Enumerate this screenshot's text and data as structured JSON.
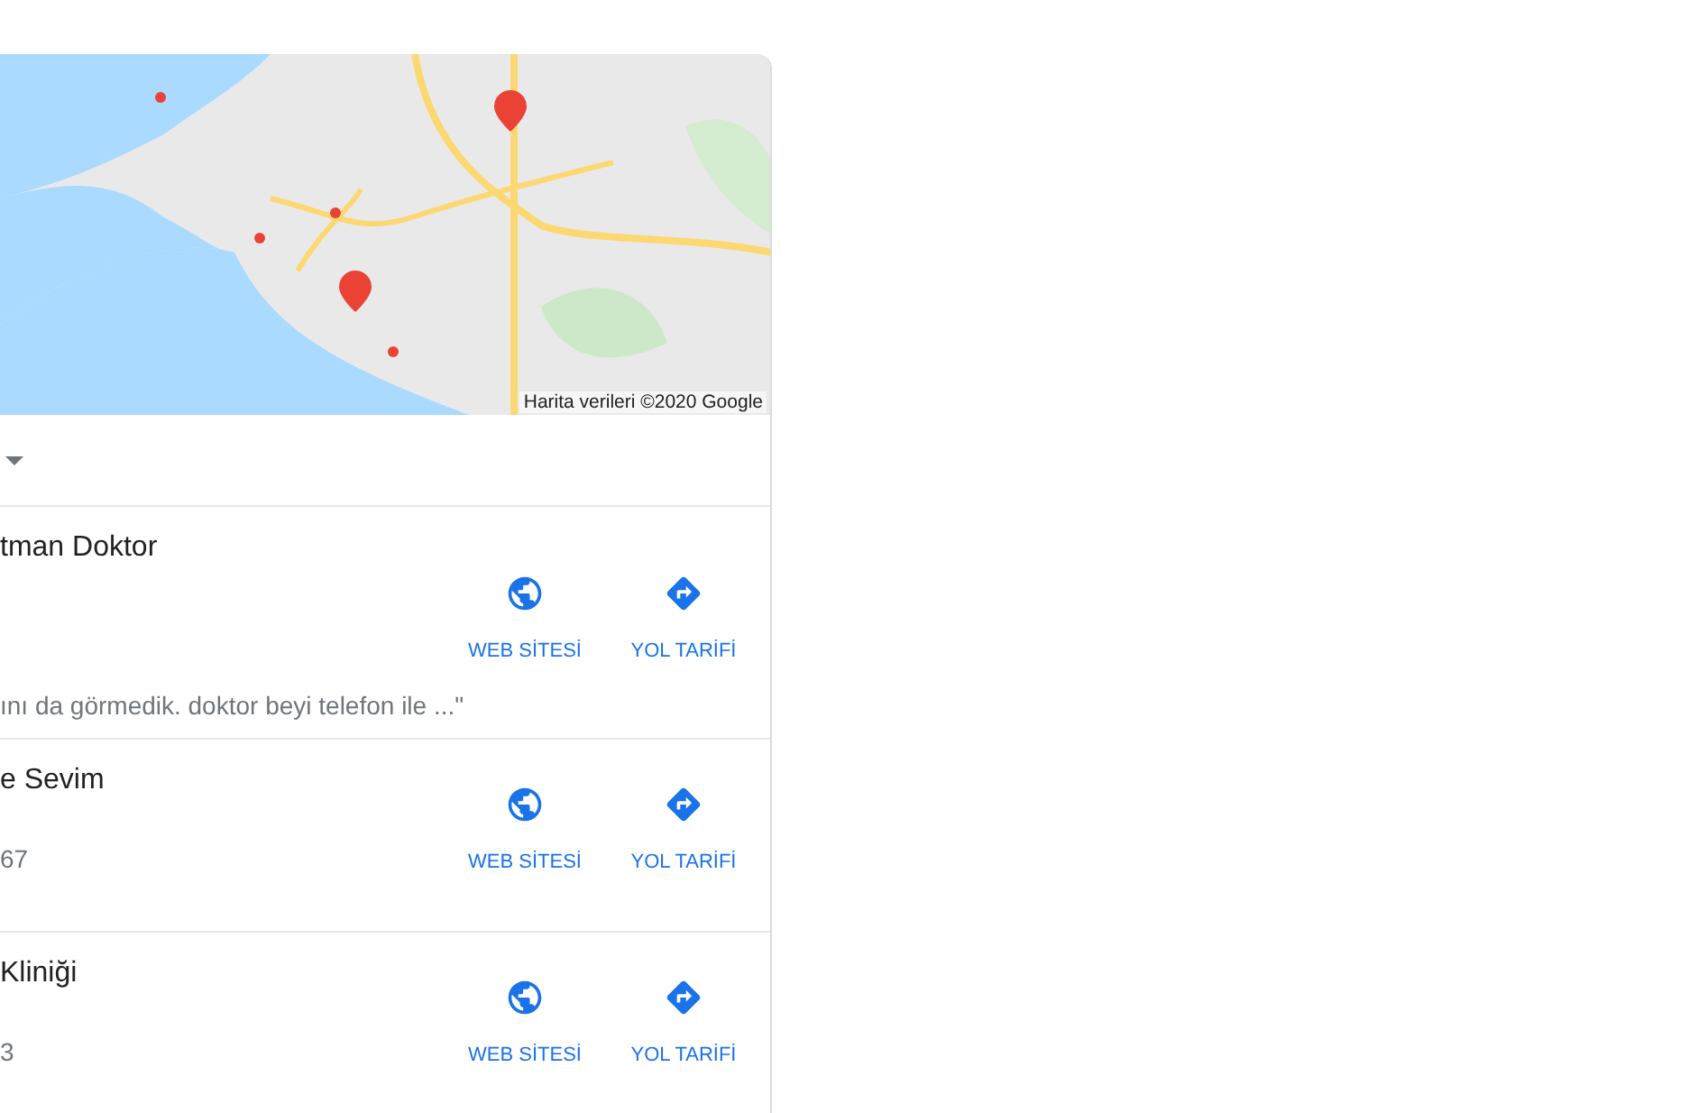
{
  "map": {
    "attribution": "Harita verileri ©2020 Google"
  },
  "results": [
    {
      "name": "tman Doktor",
      "snippet": "ını da görmedik. doktor beyi telefon ile ...\"",
      "actions": [
        {
          "kind": "website",
          "label": "WEB SİTESİ"
        },
        {
          "kind": "directions",
          "label": "YOL TARİFİ"
        }
      ]
    },
    {
      "name": "e Sevim",
      "meta": "67",
      "actions": [
        {
          "kind": "website",
          "label": "WEB SİTESİ"
        },
        {
          "kind": "directions",
          "label": "YOL TARİFİ"
        }
      ]
    },
    {
      "name": "Kliniği",
      "meta": "3",
      "actions": [
        {
          "kind": "website",
          "label": "WEB SİTESİ"
        },
        {
          "kind": "directions",
          "label": "YOL TARİFİ"
        }
      ]
    }
  ]
}
